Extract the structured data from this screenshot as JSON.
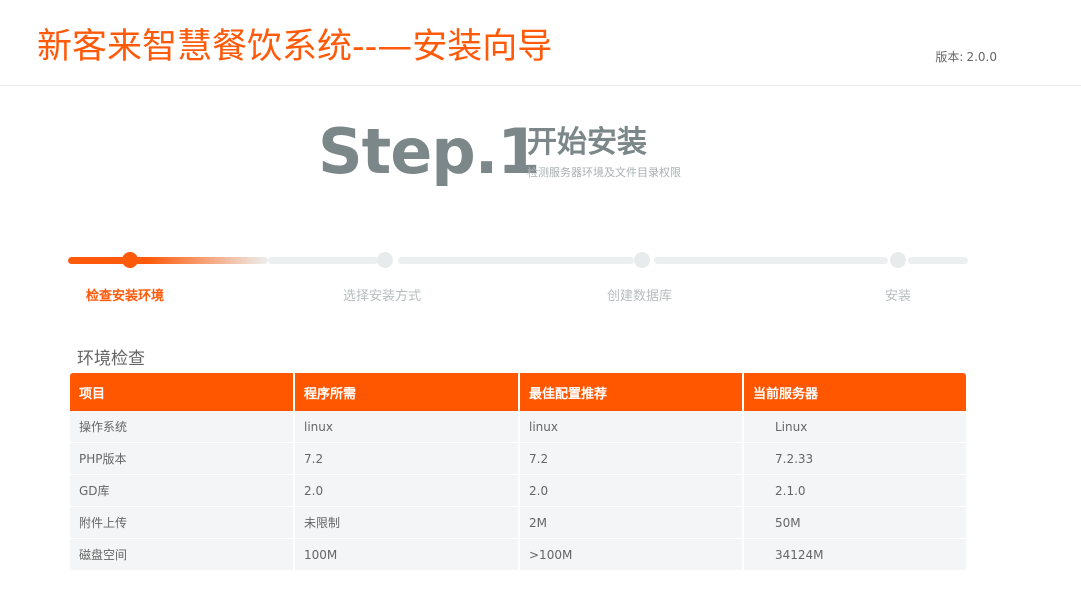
{
  "header": {
    "title": "新客来智慧餐饮系统--—安装向导",
    "version_prefix": "版本:",
    "version": "2.0.0"
  },
  "banner": {
    "step": "Step.1",
    "heading": "开始安装",
    "subtitle": "检测服务器环境及文件目录权限"
  },
  "steps": [
    {
      "label": "检查安装环境",
      "active": true
    },
    {
      "label": "选择安装方式",
      "active": false
    },
    {
      "label": "创建数据库",
      "active": false
    },
    {
      "label": "安装",
      "active": false
    }
  ],
  "env_check": {
    "title": "环境检查",
    "columns": [
      "项目",
      "程序所需",
      "最佳配置推荐",
      "当前服务器"
    ],
    "rows": [
      [
        "操作系统",
        "linux",
        "linux",
        "Linux"
      ],
      [
        "PHP版本",
        "7.2",
        "7.2",
        "7.2.33"
      ],
      [
        "GD库",
        "2.0",
        "2.0",
        "2.1.0"
      ],
      [
        "附件上传",
        "未限制",
        "2M",
        "50M"
      ],
      [
        "磁盘空间",
        "100M",
        ">100M",
        "34124M"
      ]
    ]
  },
  "colors": {
    "accent": "#ff5a0a",
    "step_gray": "#7c8789",
    "table_row_bg": "#f4f5f6"
  }
}
